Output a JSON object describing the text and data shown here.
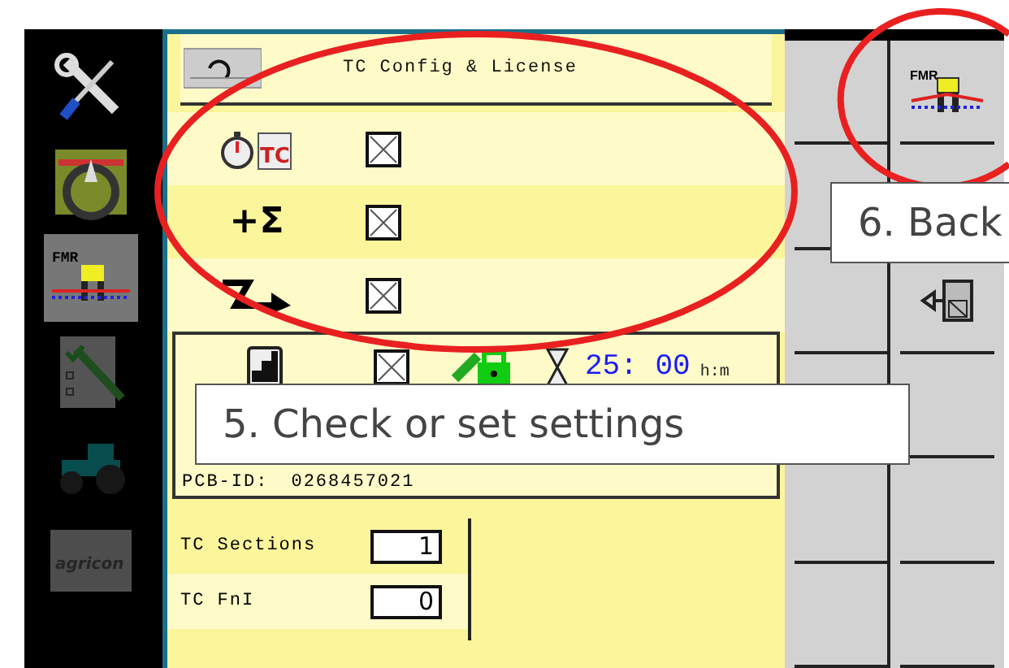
{
  "sidebar": {
    "items": [
      {
        "kind": "tools",
        "selected": false,
        "disabled": false
      },
      {
        "kind": "steering",
        "selected": false,
        "disabled": false
      },
      {
        "kind": "sprayer",
        "label": "FMR",
        "selected": true,
        "disabled": false
      },
      {
        "kind": "checklist",
        "selected": false,
        "disabled": true
      },
      {
        "kind": "tractor",
        "selected": false,
        "disabled": true
      },
      {
        "kind": "logo",
        "label": "agricon",
        "selected": false,
        "disabled": true
      }
    ]
  },
  "header": {
    "title": "TC Config & License"
  },
  "settings": [
    {
      "kind": "timer-tc",
      "badge": "TC",
      "checked": true
    },
    {
      "kind": "sum",
      "symbol": "+Σ",
      "checked": true
    },
    {
      "kind": "arrow",
      "checked": true
    }
  ],
  "license": {
    "checked": true,
    "time": "25: 00",
    "unit": "h:m",
    "pcb_label": "PCB-ID:",
    "pcb_id": "0268457021"
  },
  "fields": [
    {
      "label": "TC Sections",
      "value": "1"
    },
    {
      "label": "TC FnI",
      "value": "0"
    }
  ],
  "softkeys": [
    {
      "kind": "implement",
      "label": "FMR"
    },
    {
      "kind": "blank"
    },
    {
      "kind": "back"
    },
    {
      "kind": "blank"
    },
    {
      "kind": "blank"
    },
    {
      "kind": "blank"
    }
  ],
  "annotations": [
    {
      "kind": "callout",
      "text": "5. Check or set settings"
    },
    {
      "kind": "callout",
      "text": "6. Back"
    }
  ]
}
